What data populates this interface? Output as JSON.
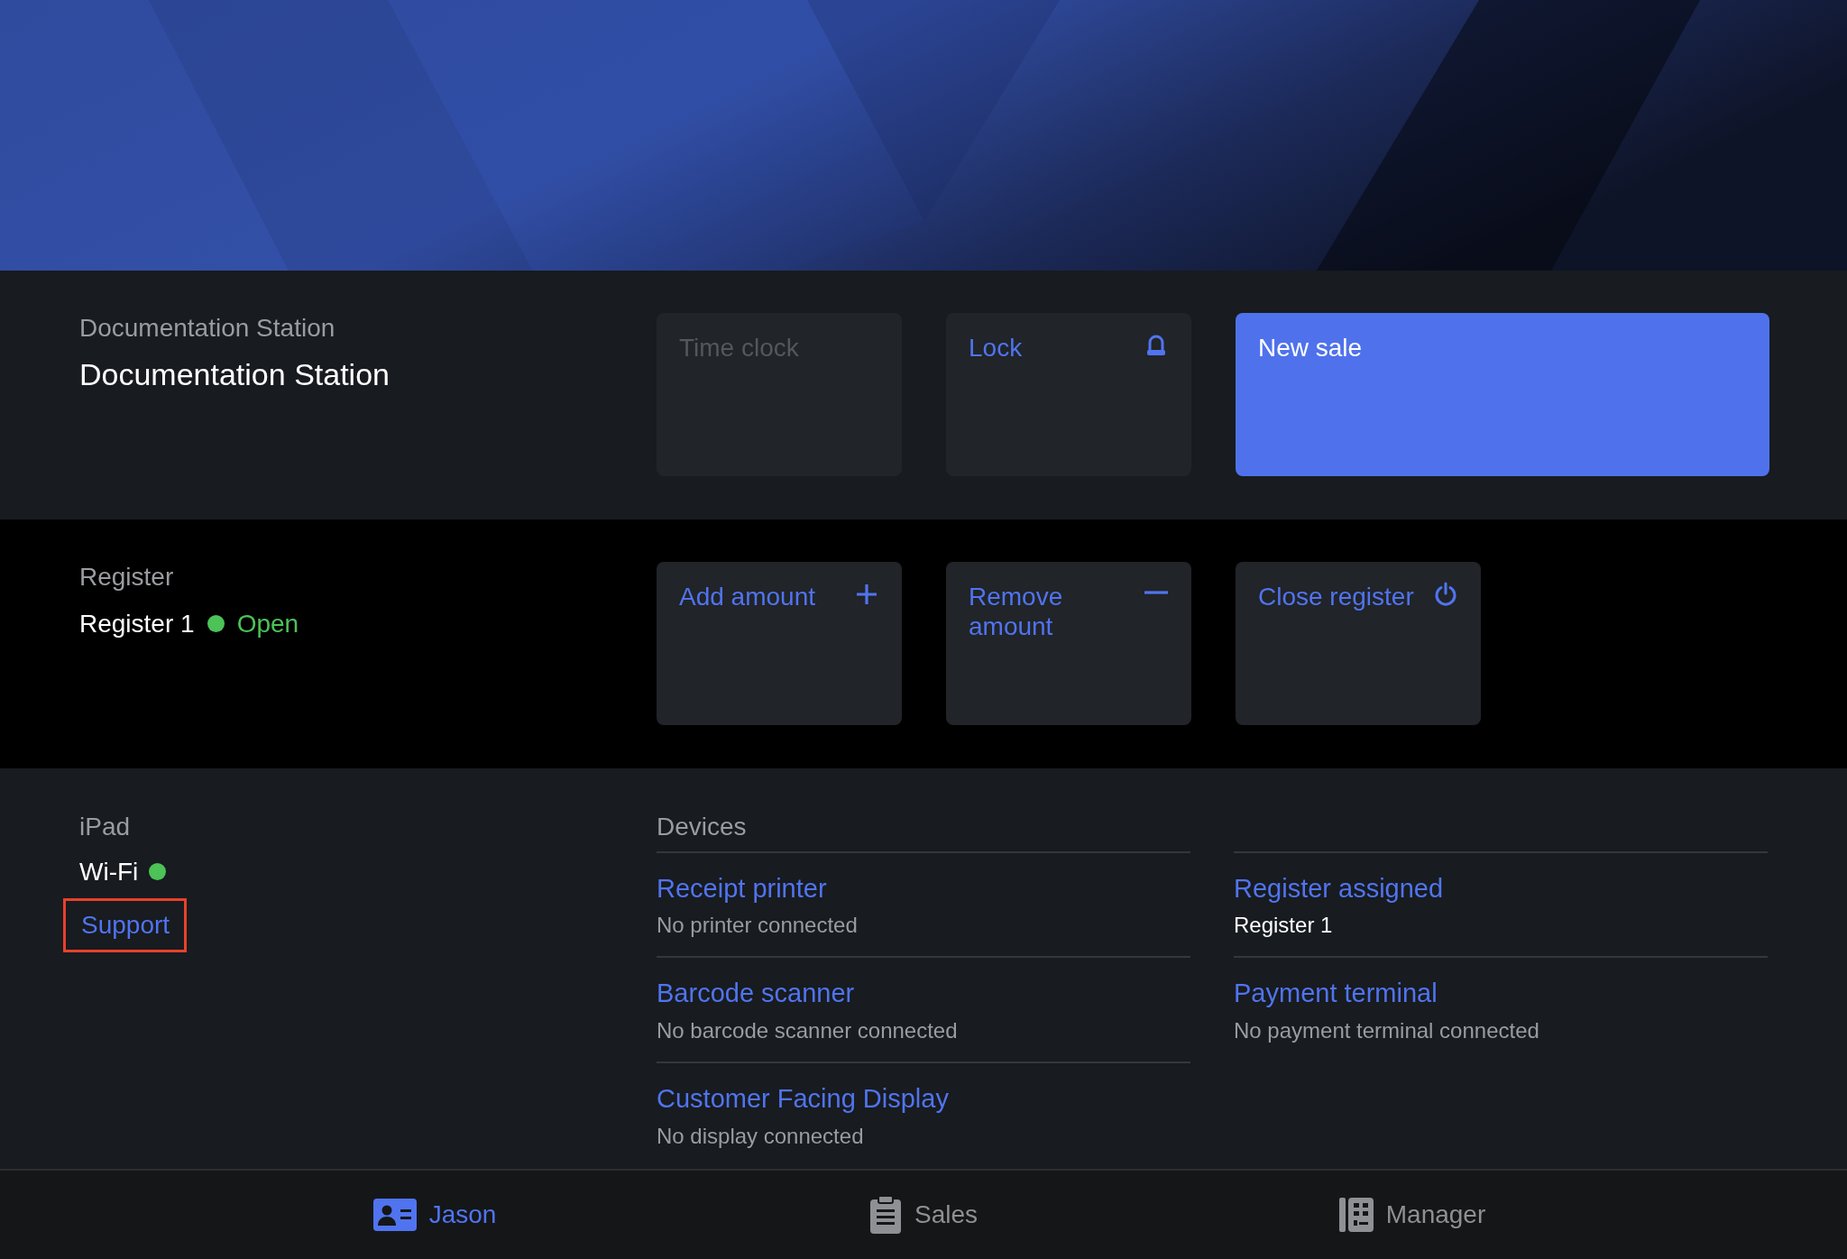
{
  "station": {
    "label": "Documentation Station",
    "name": "Documentation Station"
  },
  "station_actions": [
    {
      "label": "Time clock",
      "kind": "plain",
      "disabled": true
    },
    {
      "label": "Lock",
      "kind": "lock",
      "disabled": false
    },
    {
      "label": "New sale",
      "kind": "primary",
      "disabled": false
    }
  ],
  "register": {
    "label": "Register",
    "name": "Register 1",
    "status": "Open",
    "open": true
  },
  "register_actions": [
    {
      "label": "Add amount",
      "kind": "plus",
      "disabled": false
    },
    {
      "label": "Remove amount",
      "kind": "minus",
      "disabled": false
    },
    {
      "label": "Close register",
      "kind": "power",
      "disabled": false
    }
  ],
  "ipad": {
    "label": "iPad",
    "wifi": "Wi-Fi",
    "wifi_connected": true,
    "support": "Support",
    "support_highlighted": true
  },
  "devices": {
    "title": "Devices",
    "columns": [
      [
        {
          "name": "Receipt printer",
          "status": "No printer connected",
          "assigned": false
        },
        {
          "name": "Barcode scanner",
          "status": "No barcode scanner connected",
          "assigned": false
        },
        {
          "name": "Customer Facing Display",
          "status": "No display connected",
          "assigned": false
        }
      ],
      [
        {
          "name": "Register assigned",
          "status": "Register 1",
          "assigned": true
        },
        {
          "name": "Payment terminal",
          "status": "No payment terminal connected",
          "assigned": false
        }
      ]
    ]
  },
  "tabs": [
    {
      "label": "Jason",
      "selected": true
    },
    {
      "label": "Sales",
      "selected": false
    },
    {
      "label": "Manager",
      "selected": false
    }
  ]
}
